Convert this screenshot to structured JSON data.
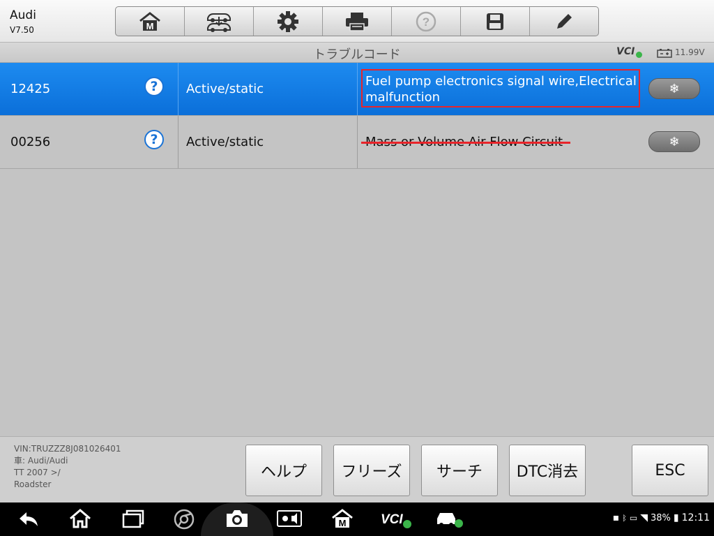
{
  "app": {
    "name": "Audi",
    "version": "V7.50"
  },
  "toolbar": {
    "buttons": [
      {
        "icon": "home-m-icon"
      },
      {
        "icon": "vehicle-icon"
      },
      {
        "icon": "gear-icon"
      },
      {
        "icon": "printer-icon"
      },
      {
        "icon": "help-icon"
      },
      {
        "icon": "save-icon"
      },
      {
        "icon": "pencil-icon"
      }
    ]
  },
  "header": {
    "title": "トラブルコード",
    "vci": "VCI",
    "voltage": "11.99V"
  },
  "dtc_rows": [
    {
      "code": "12425",
      "status": "Active/static",
      "description": "Fuel pump electronics signal wire,Electrical malfunction",
      "selected": true
    },
    {
      "code": "00256",
      "status": "Active/static",
      "description": "Mass or Volume Air Flow Circuit",
      "selected": false
    }
  ],
  "freeze_symbol": "❄",
  "vehicle": {
    "vin": "VIN:TRUZZZ8J081026401",
    "make": "車: Audi/Audi",
    "model": "TT 2007 >/",
    "body": "Roadster"
  },
  "buttons": {
    "help": "ヘルプ",
    "freeze": "フリーズ",
    "search": "サーチ",
    "clear_dtc": "DTC消去",
    "esc": "ESC"
  },
  "statusbar": {
    "battery": "38%",
    "time": "12:11"
  },
  "colors": {
    "selected_row": "#0b6fd9",
    "highlight_red": "#e8242a",
    "vci_green": "#3bb54a"
  }
}
